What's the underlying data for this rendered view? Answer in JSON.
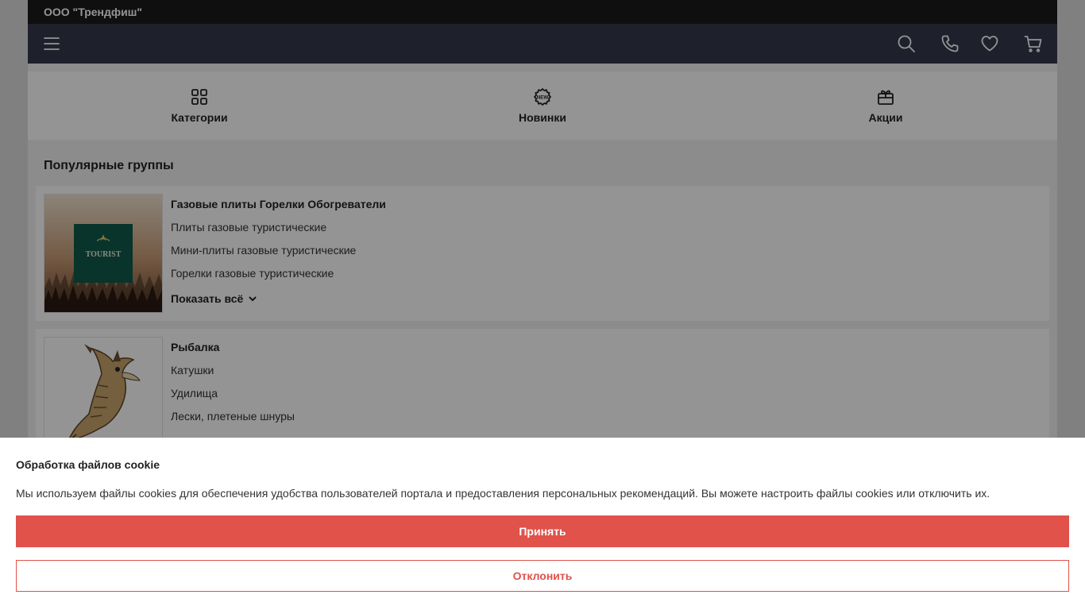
{
  "company": "ООО \"Трендфиш\"",
  "navbar": {
    "icons": [
      "menu-icon",
      "search-icon",
      "phone-icon",
      "heart-icon",
      "cart-icon"
    ]
  },
  "quick_nav": [
    {
      "label": "Категории",
      "icon": "grid-icon"
    },
    {
      "label": "Новинки",
      "icon": "new-badge-icon",
      "badge_text": "NEW"
    },
    {
      "label": "Акции",
      "icon": "gift-icon"
    }
  ],
  "popular": {
    "title": "Популярные группы",
    "groups": [
      {
        "title": "Газовые плиты Горелки Обогреватели",
        "logo_text": "TOURIST",
        "items": [
          "Плиты газовые туристические",
          "Мини-плиты газовые туристические",
          "Горелки газовые туристические"
        ],
        "show_all": "Показать всё"
      },
      {
        "title": "Рыбалка",
        "items": [
          "Катушки",
          "Удилища",
          "Лески, плетеные шнуры"
        ]
      }
    ]
  },
  "cookie": {
    "title": "Обработка файлов cookie",
    "text": "Мы используем файлы cookies для обеспечения удобства пользователей портала и предоставления персональных рекомендаций. Вы можете настроить файлы cookies или отключить их.",
    "accept": "Принять",
    "decline": "Отклонить"
  },
  "colors": {
    "topbar": "#1b1b1d",
    "navbar": "#353a4d",
    "accent": "#e0524a"
  }
}
